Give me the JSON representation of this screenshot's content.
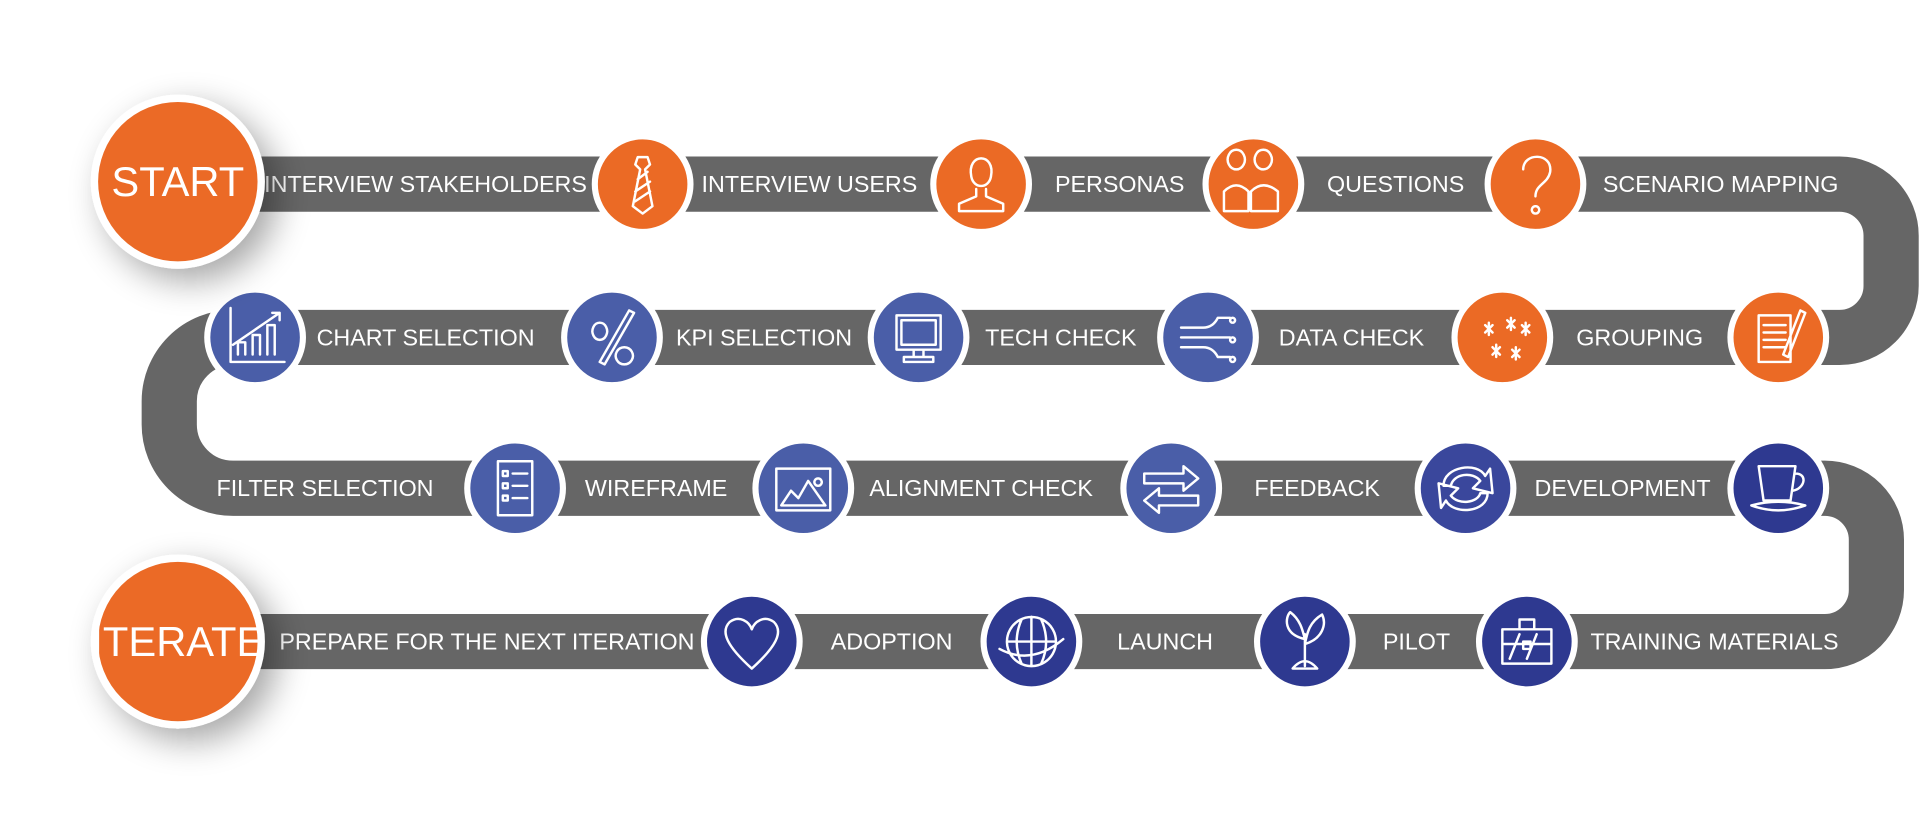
{
  "colors": {
    "path": "#666666",
    "orange": "#EB6A25",
    "blue": "#4A5EA8",
    "mid_blue": "#3A479C",
    "dark_blue": "#2E3990",
    "border": "#ffffff"
  },
  "start": {
    "label": "START"
  },
  "iterate": {
    "label": "ITERATE"
  },
  "labels": [
    "INTERVIEW STAKEHOLDERS",
    "INTERVIEW USERS",
    "PERSONAS",
    "QUESTIONS",
    "SCENARIO MAPPING",
    "CHART SELECTION",
    "KPI SELECTION",
    "TECH CHECK",
    "DATA CHECK",
    "GROUPING",
    "FILTER SELECTION",
    "WIREFRAME",
    "ALIGNMENT CHECK",
    "FEEDBACK",
    "DEVELOPMENT",
    "PREPARE FOR THE NEXT ITERATION",
    "ADOPTION",
    "LAUNCH",
    "PILOT",
    "TRAINING MATERIALS"
  ],
  "icons": [
    {
      "name": "tie-icon",
      "color": "orange"
    },
    {
      "name": "user-icon",
      "color": "orange"
    },
    {
      "name": "people-icon",
      "color": "orange"
    },
    {
      "name": "question-mark-icon",
      "color": "orange"
    },
    {
      "name": "notepad-pencil-icon",
      "color": "orange"
    },
    {
      "name": "asterisks-icon",
      "color": "orange"
    },
    {
      "name": "connectors-icon",
      "color": "blue"
    },
    {
      "name": "monitor-icon",
      "color": "blue"
    },
    {
      "name": "percent-icon",
      "color": "blue"
    },
    {
      "name": "bar-chart-icon",
      "color": "blue"
    },
    {
      "name": "checklist-icon",
      "color": "blue"
    },
    {
      "name": "image-frame-icon",
      "color": "blue"
    },
    {
      "name": "opposite-arrows-icon",
      "color": "blue"
    },
    {
      "name": "cycle-arrows-icon",
      "color": "mid_blue"
    },
    {
      "name": "teacup-icon",
      "color": "dark_blue"
    },
    {
      "name": "briefcase-icon",
      "color": "dark_blue"
    },
    {
      "name": "plant-icon",
      "color": "dark_blue"
    },
    {
      "name": "globe-icon",
      "color": "dark_blue"
    },
    {
      "name": "heart-icon",
      "color": "dark_blue"
    }
  ]
}
